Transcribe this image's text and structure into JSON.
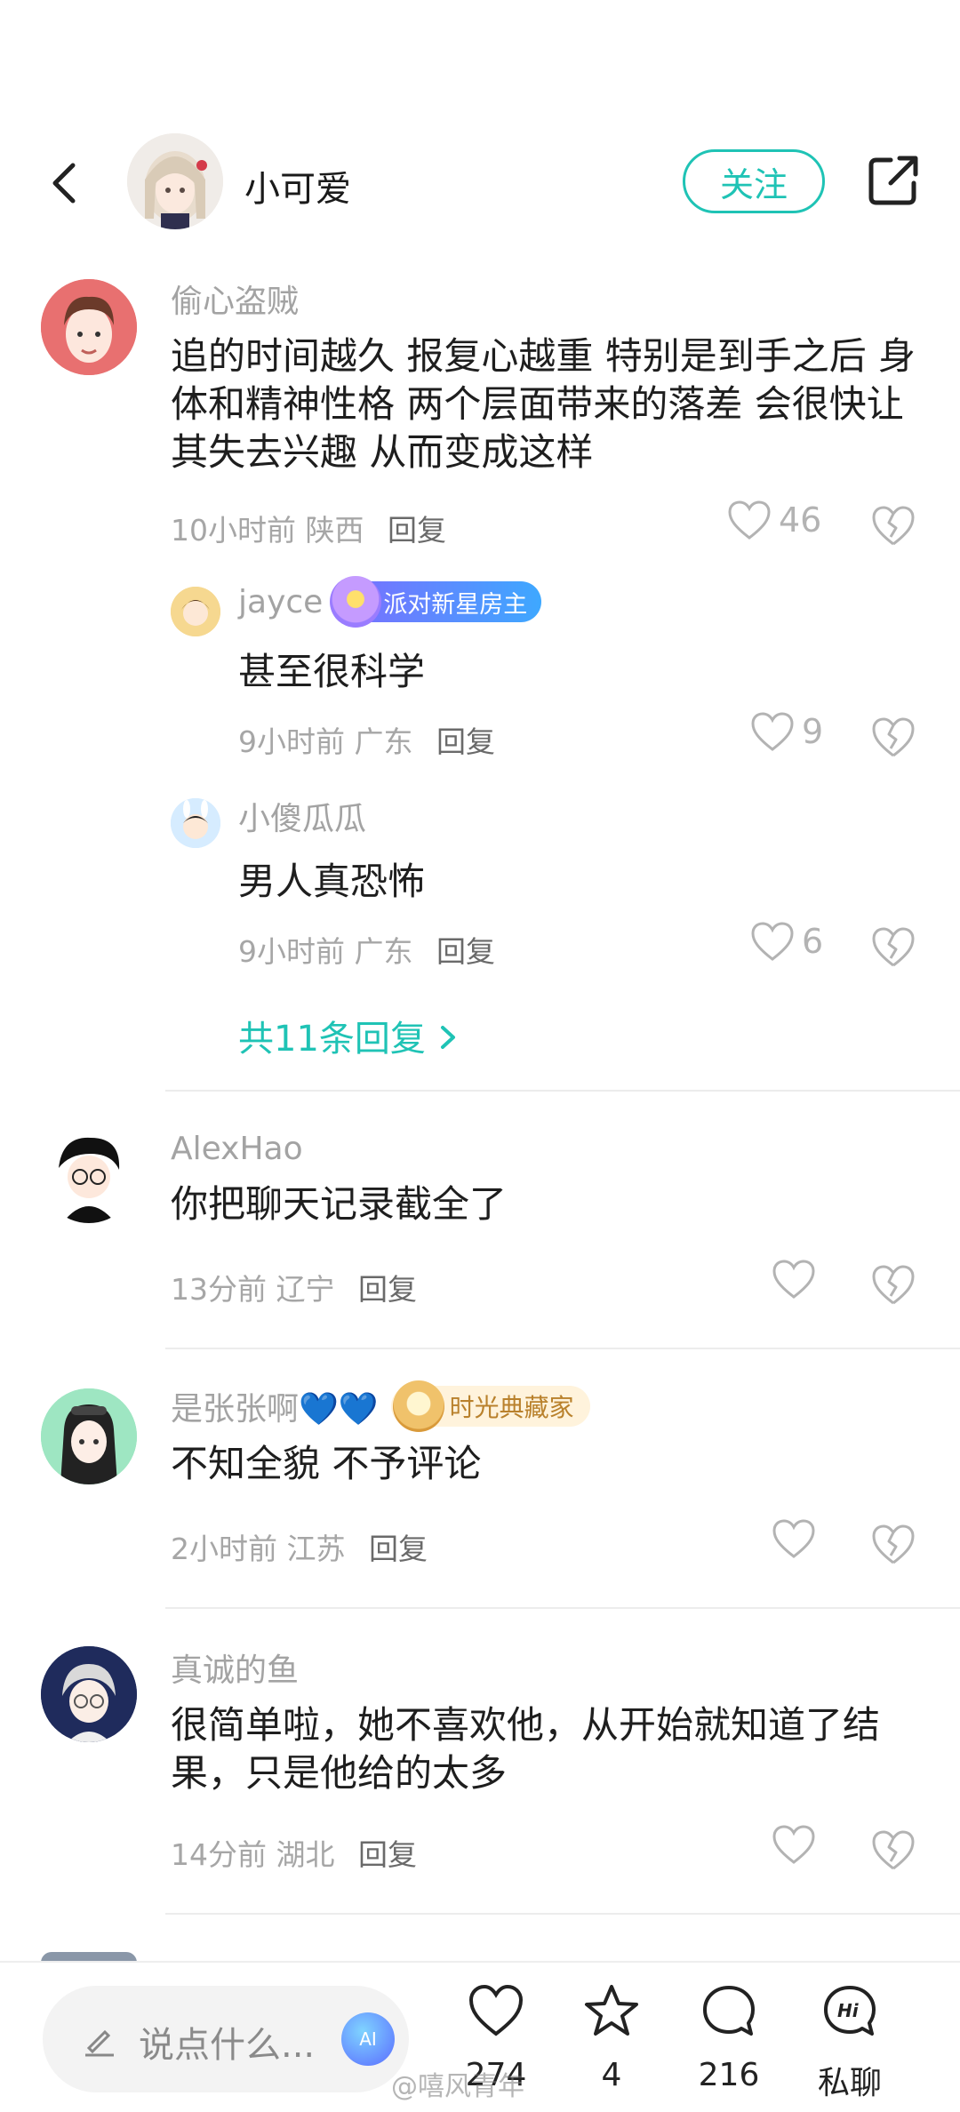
{
  "header": {
    "username": "小可爱",
    "follow_label": "关注"
  },
  "comments": [
    {
      "name": "偷心盗贼",
      "text": "追的时间越久 报复心越重  特别是到手之后 身体和精神性格 两个层面带来的落差 会很快让其失去兴趣 从而变成这样",
      "time": "10小时前",
      "location": "陕西",
      "reply_label": "回复",
      "likes": "46",
      "sub_replies": [
        {
          "name": "jayce",
          "badge": "派对新星房主",
          "text": "甚至很科学",
          "time": "9小时前",
          "location": "广东",
          "reply_label": "回复",
          "likes": "9"
        },
        {
          "name": "小傻瓜瓜",
          "text": "男人真恐怖",
          "time": "9小时前",
          "location": "广东",
          "reply_label": "回复",
          "likes": "6"
        }
      ],
      "more_replies": "共11条回复"
    },
    {
      "name": "AlexHao",
      "text": "你把聊天记录截全了",
      "time": "13分前",
      "location": "辽宁",
      "reply_label": "回复"
    },
    {
      "name": "是张张啊💙💙",
      "badge": "时光典藏家",
      "text": "不知全貌 不予评论",
      "time": "2小时前",
      "location": "江苏",
      "reply_label": "回复"
    },
    {
      "name": "真诚的鱼",
      "text": "很简单啦，她不喜欢他，从开始就知道了结果，只是他给的太多",
      "time": "14分前",
      "location": "湖北",
      "reply_label": "回复"
    }
  ],
  "bottom_bar": {
    "input_placeholder": "说点什么...",
    "likes": "274",
    "stars": "4",
    "comments": "216",
    "chat_label": "私聊",
    "ai_label": "AI"
  },
  "watermark": "@嘻风青年",
  "colors": {
    "accent": "#1fc3b5"
  }
}
